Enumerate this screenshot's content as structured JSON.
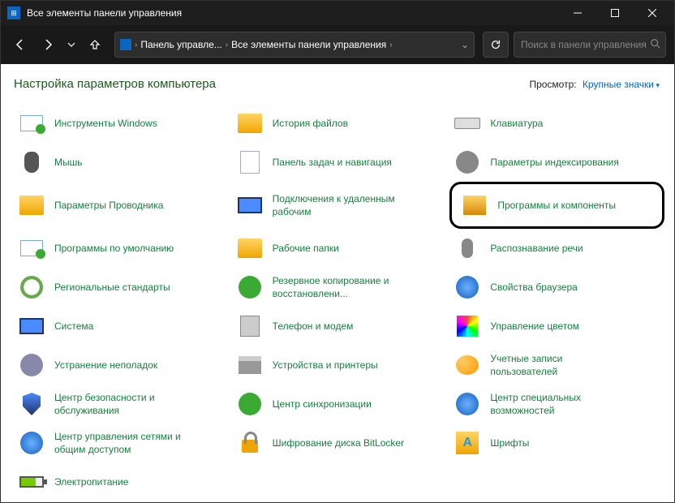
{
  "titlebar": {
    "title": "Все элементы панели управления"
  },
  "breadcrumb": {
    "root_icon": "control-panel-icon",
    "crumbs": [
      "Панель управле...",
      "Все элементы панели управления"
    ]
  },
  "search": {
    "placeholder": "Поиск в панели управления"
  },
  "heading": "Настройка параметров компьютера",
  "view_by": {
    "label": "Просмотр:",
    "value": "Крупные значки"
  },
  "items": {
    "r0c0": "Инструменты Windows",
    "r0c1": "История файлов",
    "r0c2": "Клавиатура",
    "r1c0": "Мышь",
    "r1c1": "Панель задач и навигация",
    "r1c2": "Параметры индексирования",
    "r2c0": "Параметры Проводника",
    "r2c1": "Подключения к удаленным рабочим",
    "r2c2": "Программы и компоненты",
    "r3c0": "Программы по умолчанию",
    "r3c1": "Рабочие папки",
    "r3c2": "Распознавание речи",
    "r4c0": "Региональные стандарты",
    "r4c1": "Резервное копирование и восстановлени...",
    "r4c2": "Свойства браузера",
    "r5c0": "Система",
    "r5c1": "Телефон и модем",
    "r5c2": "Управление цветом",
    "r6c0": "Устранение неполадок",
    "r6c1": "Устройства и принтеры",
    "r6c2": "Учетные записи пользователей",
    "r7c0": "Центр безопасности и обслуживания",
    "r7c1": "Центр синхронизации",
    "r7c2": "Центр специальных возможностей",
    "r8c0": "Центр управления сетями и общим доступом",
    "r8c1": "Шифрование диска BitLocker",
    "r8c2": "Шрифты",
    "r9c0": "Электропитание"
  }
}
